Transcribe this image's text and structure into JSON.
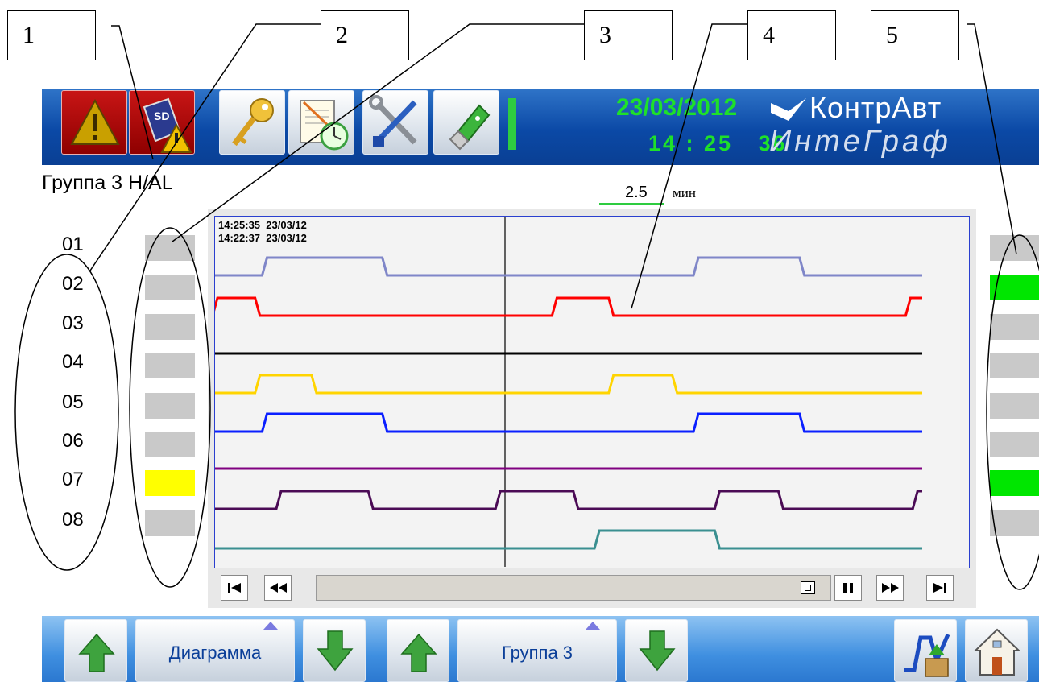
{
  "callouts": [
    "1",
    "2",
    "3",
    "4",
    "5"
  ],
  "header": {
    "date": "23/03/2012",
    "time": "14 : 25   36",
    "brand_top": "КонтрАвт",
    "brand_bottom": "ИнтеГраф"
  },
  "toolbar": {
    "icons": [
      "alarm-icon",
      "sd-card-warning-icon",
      "key-icon",
      "notepad-clock-icon",
      "tools-icon",
      "usb-icon"
    ]
  },
  "group": {
    "title": "Группа 3 H/AL"
  },
  "scale": {
    "value": "2.5",
    "unit": "мин"
  },
  "channels": [
    "01",
    "02",
    "03",
    "04",
    "05",
    "06",
    "07",
    "08"
  ],
  "left_indicators": [
    "#c9c9c9",
    "#c9c9c9",
    "#c9c9c9",
    "#c9c9c9",
    "#c9c9c9",
    "#c9c9c9",
    "#ffff00",
    "#c9c9c9"
  ],
  "right_indicators": [
    "#c9c9c9",
    "#00e600",
    "#c9c9c9",
    "#c9c9c9",
    "#c9c9c9",
    "#c9c9c9",
    "#00e600",
    "#c9c9c9"
  ],
  "trend": {
    "timestamp_top": "14:25:35  23/03/12",
    "timestamp_bottom": "14:22:37  23/03/12",
    "series": [
      {
        "channel": "01",
        "color": "#7f86c8",
        "high_intervals": [
          [
            0.07,
            0.24
          ],
          [
            0.68,
            0.83
          ]
        ]
      },
      {
        "channel": "02",
        "color": "#ff0000",
        "high_intervals": [
          [
            0.0,
            0.06
          ],
          [
            0.48,
            0.56
          ],
          [
            0.98,
            1.0
          ]
        ]
      },
      {
        "channel": "03",
        "color": "#000000",
        "high_intervals": []
      },
      {
        "channel": "04",
        "color": "#ffd400",
        "high_intervals": [
          [
            0.06,
            0.14
          ],
          [
            0.56,
            0.65
          ]
        ]
      },
      {
        "channel": "05",
        "color": "#0a1fff",
        "high_intervals": [
          [
            0.07,
            0.24
          ],
          [
            0.68,
            0.83
          ]
        ]
      },
      {
        "channel": "06",
        "color": "#800080",
        "high_intervals": []
      },
      {
        "channel": "07",
        "color": "#4b0b55",
        "high_intervals": [
          [
            0.09,
            0.22
          ],
          [
            0.4,
            0.51
          ],
          [
            0.71,
            0.8
          ],
          [
            0.99,
            1.0
          ]
        ]
      },
      {
        "channel": "08",
        "color": "#3a8f90",
        "high_intervals": [
          [
            0.54,
            0.71
          ]
        ]
      }
    ]
  },
  "bottom": {
    "diagram_label": "Диаграмма",
    "group_label": "Группа 3"
  }
}
